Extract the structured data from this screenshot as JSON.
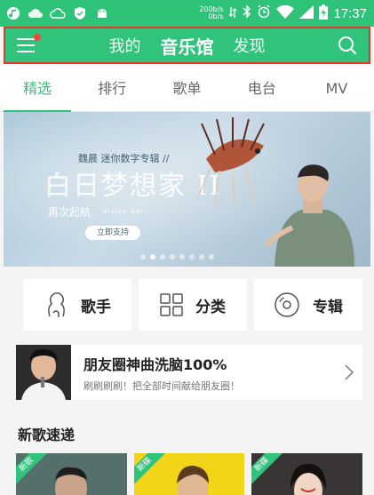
{
  "status_bar": {
    "net_speed_up": "200b/s",
    "net_speed_down": "0b/s",
    "time": "17:37"
  },
  "header": {
    "nav": [
      "我的",
      "音乐馆",
      "发现"
    ],
    "active_nav": "音乐馆"
  },
  "tabs": [
    "精选",
    "排行",
    "歌单",
    "电台",
    "MV"
  ],
  "active_tab": "精选",
  "banner": {
    "artist_line": "魏晨 迷你数字专辑 //",
    "title": "白日梦想家 II",
    "subtitle": "再次起航",
    "english_name": "Vision Wei",
    "cta": "立即支持",
    "page_count": 8,
    "current_page": 2
  },
  "quick_links": [
    {
      "label": "歌手",
      "icon": "singer-icon"
    },
    {
      "label": "分类",
      "icon": "category-grid-icon"
    },
    {
      "label": "专辑",
      "icon": "album-disc-icon"
    }
  ],
  "promo": {
    "title": "朋友圈神曲洗脑100%",
    "subtitle": "刷刷刷刷！把全部时间献给朋友圈！"
  },
  "new_songs": {
    "title": "新歌速递",
    "badges": [
      "新歌",
      "新碟",
      "新碟"
    ]
  },
  "colors": {
    "brand_green": "#31c27c",
    "highlight_border": "#e03a2f",
    "notification_dot": "#f0463a"
  }
}
